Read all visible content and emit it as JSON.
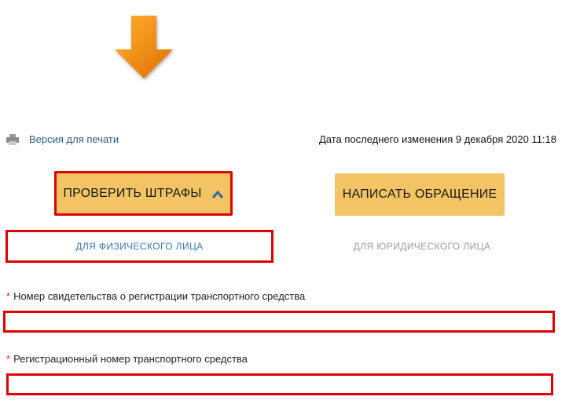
{
  "header": {
    "print_label": "Версия для печати",
    "last_modified": "Дата последнего изменения 9 декабря 2020 11:18"
  },
  "buttons": {
    "check_fines": "ПРОВЕРИТЬ ШТРАФЫ",
    "write_appeal": "НАПИСАТЬ ОБРАЩЕНИЕ"
  },
  "tabs": {
    "individual": "ДЛЯ ФИЗИЧЕСКОГО ЛИЦА",
    "legal_entity": "ДЛЯ ЮРИДИЧЕСКОГО ЛИЦА"
  },
  "form": {
    "required_mark": "*",
    "cert_number_label": "Номер свидетельства о регистрации транспортного средства",
    "cert_number_value": "",
    "reg_number_label": "Регистрационный номер транспортного средства",
    "reg_number_value": ""
  },
  "colors": {
    "button_bg": "#f2c463",
    "highlight": "#e00000",
    "link": "#2c5a8c",
    "tab_active": "#3a78b8",
    "tab_inactive": "#9a9a9a",
    "arrow": "#f08a0c"
  },
  "icons": {
    "arrow": "orange-down-arrow-icon",
    "print": "printer-icon",
    "chevron": "chevron-up-icon"
  }
}
